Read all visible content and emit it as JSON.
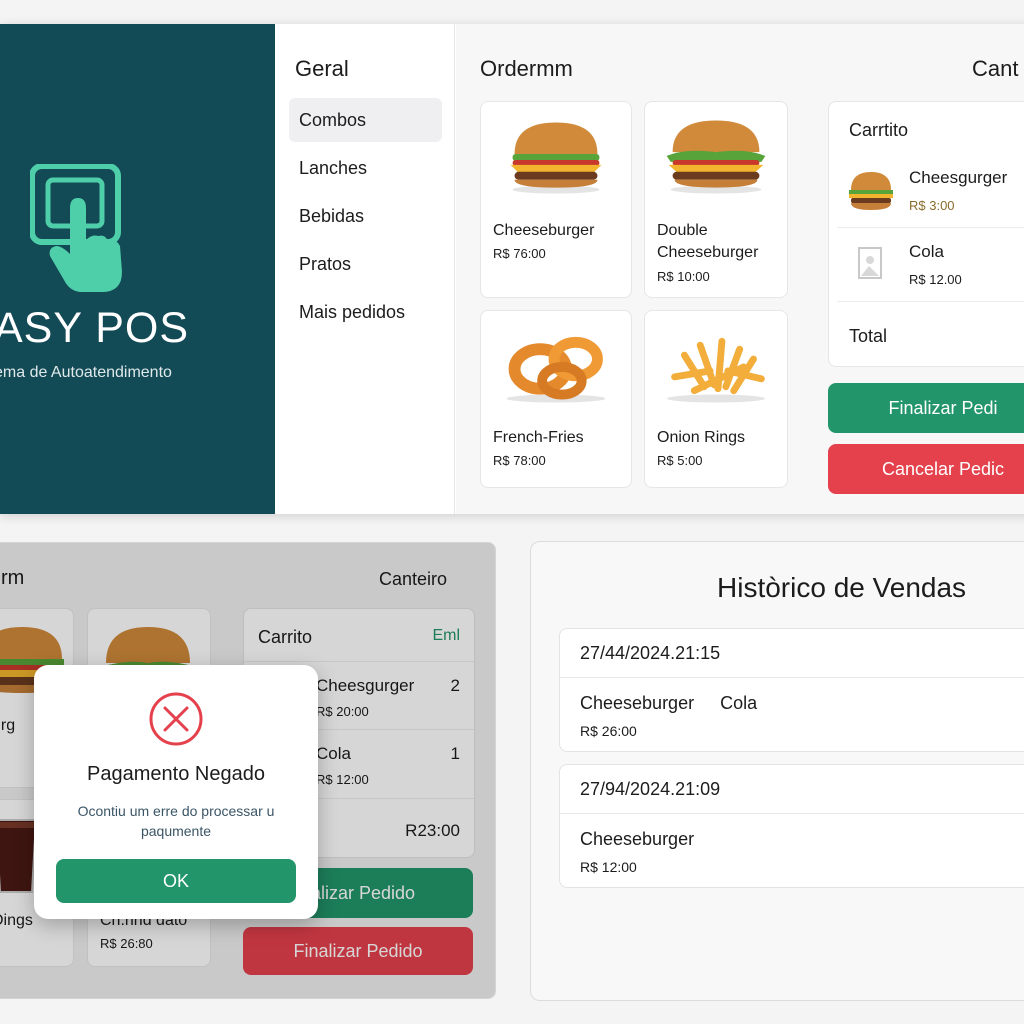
{
  "brand": {
    "name": "ASY POS",
    "tagline": "ema de Autoatendimento"
  },
  "categories": {
    "title": "Geral",
    "items": [
      {
        "label": "Combos",
        "active": true
      },
      {
        "label": "Lanches"
      },
      {
        "label": "Bebidas"
      },
      {
        "label": "Pratos"
      },
      {
        "label": "Mais pedidos"
      }
    ]
  },
  "order": {
    "title": "Ordermm",
    "cart_heading": "Cant",
    "products": [
      {
        "name": "Cheeseburger",
        "price": "R$ 76:00"
      },
      {
        "name": "Double Cheeseburger",
        "price": "R$ 10:00"
      },
      {
        "name": "French-Fries",
        "price": "R$ 78:00"
      },
      {
        "name": "Onion Rings",
        "price": "R$ 5:00"
      }
    ]
  },
  "cart": {
    "title": "Carrtito",
    "items": [
      {
        "name": "Cheesgurger",
        "price": "R$ 3:00"
      },
      {
        "name": "Cola",
        "price": "R$ 12.00"
      }
    ],
    "total_label": "Total",
    "finalize_label": "Finalizar Pedi",
    "cancel_label": "Cancelar Pedic"
  },
  "second_screen": {
    "title": "rm",
    "cart_heading": "Canteiro",
    "products": [
      {
        "name": "urg"
      },
      {
        "name": ""
      },
      {
        "name": "Dings"
      },
      {
        "name": "Cn.nnd dato",
        "price": "R$ 26:80"
      }
    ],
    "cart": {
      "title": "Carrito",
      "action": "Eml",
      "items": [
        {
          "name": "Cheesgurger",
          "price": "R$ 20:00",
          "qty": "2"
        },
        {
          "name": "Cola",
          "price": "R$ 12:00",
          "qty": "1"
        }
      ],
      "total": "R23:00",
      "finalize_label": "halizar Pedido",
      "finalize2_label": "Finalizar Pedido"
    }
  },
  "modal": {
    "title": "Pagamento Negado",
    "message": "Ocontiu um erre do processar u paqumente",
    "ok_label": "OK"
  },
  "history": {
    "title": "Històrico de Vendas",
    "entries": [
      {
        "date": "27/44/2024.21:15",
        "items": [
          "Cheeseburger",
          "Cola"
        ],
        "total": "R$ 26:00"
      },
      {
        "date": "27/94/2024.21:09",
        "items": [
          "Cheeseburger"
        ],
        "total": "R$ 12:00"
      }
    ]
  },
  "colors": {
    "brand_bg": "#124a55",
    "accent_green": "#22966a",
    "accent_red": "#e5414d",
    "icon_teal": "#4fcfa9"
  }
}
